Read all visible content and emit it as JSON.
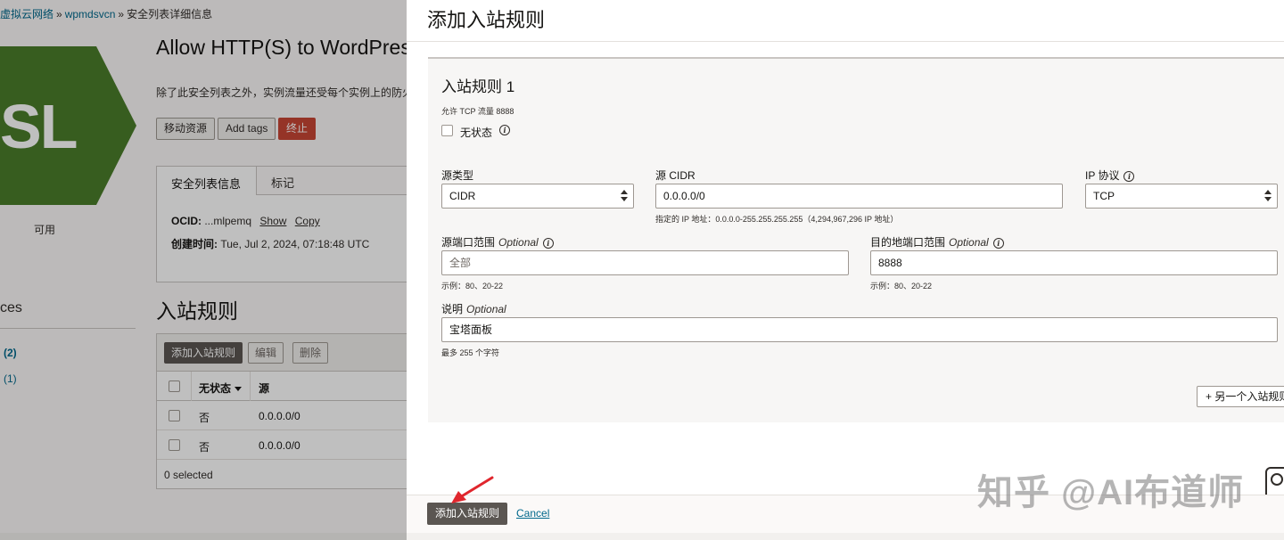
{
  "background": {
    "breadcrumb": {
      "item1": "虚拟云网络",
      "item2": "wpmdsvcn",
      "item3": "安全列表详细信息",
      "separator": "»"
    },
    "logo": {
      "text": "SL",
      "color": "#4a7c2a"
    },
    "status": "可用",
    "resources": {
      "title": "Resources",
      "link1": "(2)",
      "link2": "(1)"
    },
    "title": "Allow HTTP(S) to WordPress",
    "description": "除了此安全列表之外，实例流量还受每个实例上的防火墙规则控制。",
    "actions": {
      "move": "移动资源",
      "tags": "Add tags",
      "terminate": "终止"
    },
    "tabs": {
      "info": "安全列表信息",
      "tags": "标记"
    },
    "info": {
      "ocid_label": "OCID:",
      "ocid_value": "...mlpemq",
      "show": "Show",
      "copy": "Copy",
      "created_label": "创建时间:",
      "created_value": "Tue, Jul 2, 2024, 07:18:48 UTC"
    },
    "ingress_title": "入站规则",
    "table": {
      "add_button": "添加入站规则",
      "edit_button": "编辑",
      "delete_button": "删除",
      "headers": {
        "stateless": "无状态",
        "source": "源"
      },
      "rows": [
        {
          "stateless": "否",
          "source": "0.0.0.0/0"
        },
        {
          "stateless": "否",
          "source": "0.0.0.0/0"
        }
      ],
      "footer": "0 selected"
    }
  },
  "drawer": {
    "title": "添加入站规则",
    "rule": {
      "title": "入站规则 1",
      "description": "允许 TCP 流量 8888",
      "stateless_label": "无状态",
      "source_type": {
        "label": "源类型",
        "value": "CIDR"
      },
      "source_cidr": {
        "label": "源 CIDR",
        "value": "0.0.0.0/0",
        "hint": "指定的 IP 地址：0.0.0.0-255.255.255.255（4,294,967,296 IP 地址）"
      },
      "ip_protocol": {
        "label": "IP 协议",
        "value": "TCP"
      },
      "source_port": {
        "label": "源端口范围",
        "optional": "Optional",
        "placeholder": "全部",
        "hint": "示例：80、20-22"
      },
      "dest_port": {
        "label": "目的地端口范围",
        "optional": "Optional",
        "value": "8888",
        "hint": "示例：80、20-22"
      },
      "description_field": {
        "label": "说明",
        "optional": "Optional",
        "value": "宝塔面板",
        "hint": "最多 255 个字符"
      }
    },
    "another_rule_button": "+ 另一个入站规则",
    "submit_button": "添加入站规则",
    "cancel_link": "Cancel"
  },
  "watermark": "知乎 @AI布道师",
  "colors": {
    "accent_link": "#00688c",
    "terminate_red": "#c74634",
    "primary_button": "#5b5652",
    "arrow_red": "#e0262d"
  }
}
